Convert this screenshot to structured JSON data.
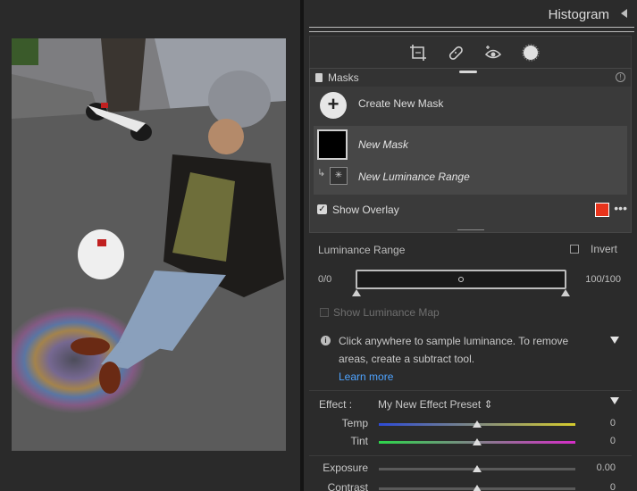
{
  "histogram": {
    "title": "Histogram"
  },
  "toolbar": {
    "tools": [
      "crop-icon",
      "healing-icon",
      "red-eye-icon",
      "masking-icon"
    ]
  },
  "masks": {
    "title": "Masks",
    "create_label": "Create New Mask",
    "mask_name": "New Mask",
    "sub_mask_name": "New Luminance Range",
    "show_overlay_label": "Show Overlay",
    "show_overlay_checked": true,
    "overlay_color": "#e8341c"
  },
  "luminance": {
    "title": "Luminance Range",
    "invert_label": "Invert",
    "range_min": "0/0",
    "range_max": "100/100",
    "show_map_label": "Show Luminance Map",
    "hint": "Click anywhere to sample luminance. To remove areas, create a subtract tool.",
    "learn_more": "Learn more"
  },
  "effect": {
    "label": "Effect :",
    "preset": "My New Effect Preset ⇕",
    "sliders": [
      {
        "label": "Temp",
        "value": "0",
        "level": 0.5
      },
      {
        "label": "Tint",
        "value": "0",
        "level": 0.5
      },
      {
        "label": "Exposure",
        "value": "0.00",
        "level": 0.5
      },
      {
        "label": "Contrast",
        "value": "0",
        "level": 0.5
      }
    ]
  },
  "colors": {
    "accent_link": "#4ea3ff",
    "panel_bg": "#2b2b2b"
  }
}
